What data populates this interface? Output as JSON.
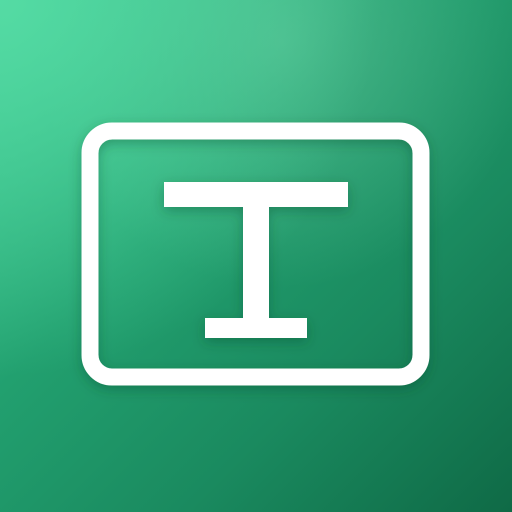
{
  "icon": {
    "name": "text-field-icon",
    "background_colors": [
      "#3cc890",
      "#22a06f",
      "#1a8a5f",
      "#0f6a46"
    ],
    "glyph_color": "#ffffff"
  }
}
